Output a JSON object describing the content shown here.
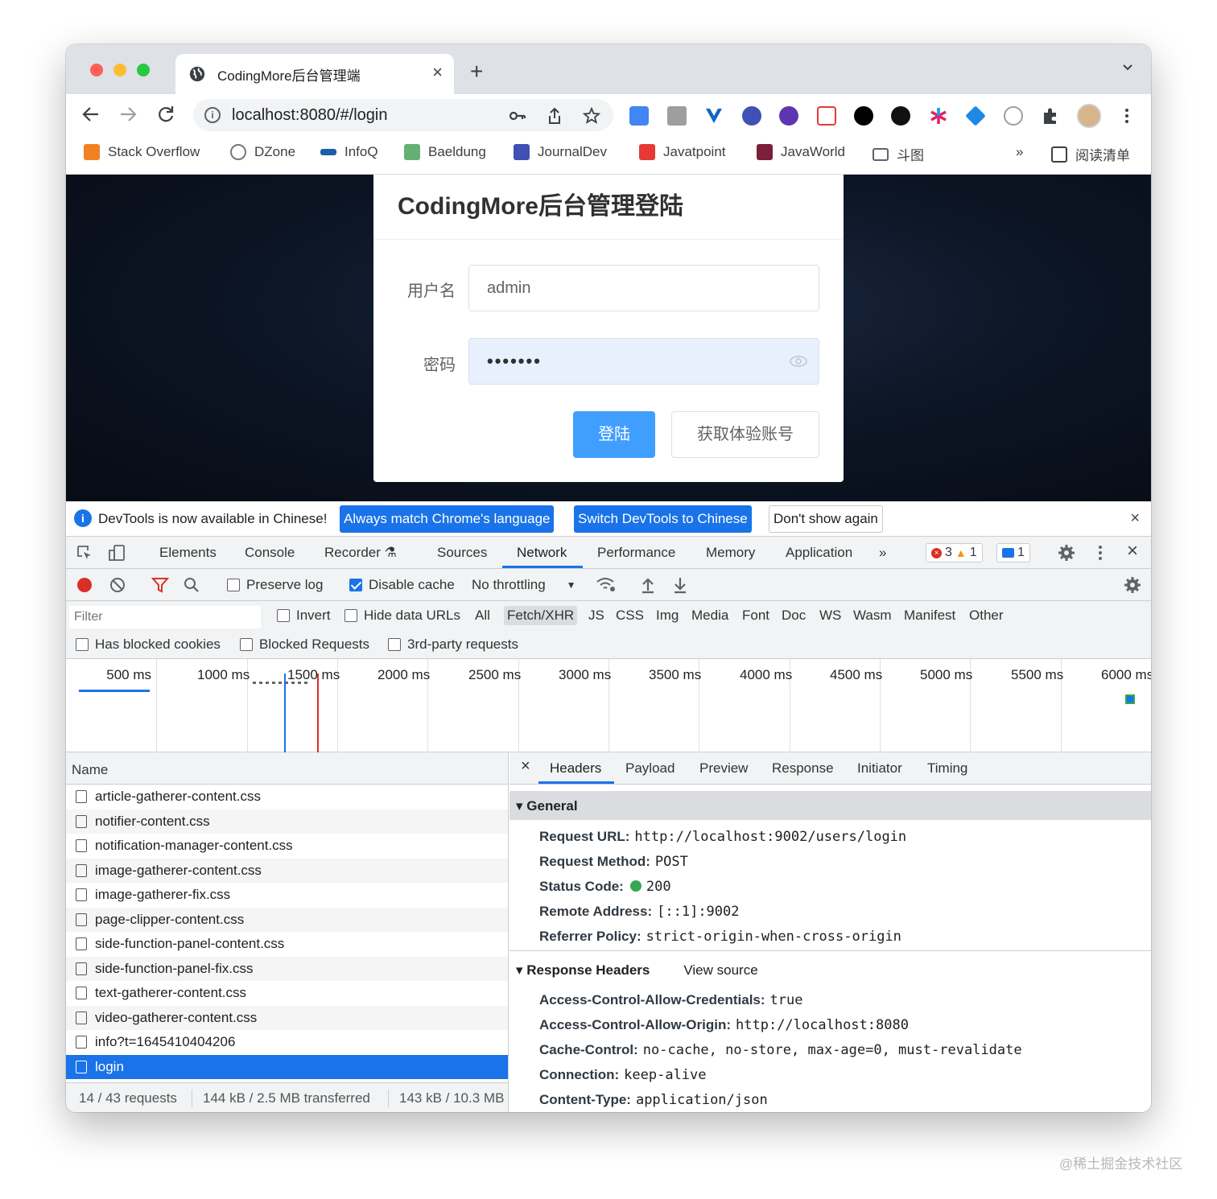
{
  "browser": {
    "tab_title": "CodingMore后台管理端",
    "url": "localhost:8080/#/login",
    "bookmarks": [
      "Stack Overflow",
      "DZone",
      "InfoQ",
      "Baeldung",
      "JournalDev",
      "Javatpoint",
      "JavaWorld",
      "斗图"
    ],
    "overflow": "»",
    "reading_list": "阅读清单"
  },
  "page": {
    "title": "CodingMore后台管理登陆",
    "username_label": "用户名",
    "username_value": "admin",
    "password_label": "密码",
    "password_value": "•••••••",
    "login_button": "登陆",
    "trial_button": "获取体验账号"
  },
  "devtools": {
    "infobar": {
      "message": "DevTools is now available in Chinese!",
      "btn_match": "Always match Chrome's language",
      "btn_switch": "Switch DevTools to Chinese",
      "btn_dismiss": "Don't show again"
    },
    "tabs": [
      "Elements",
      "Console",
      "Recorder",
      "Sources",
      "Network",
      "Performance",
      "Memory",
      "Application"
    ],
    "more_tabs": "»",
    "errors": "3",
    "warnings": "1",
    "messages": "1",
    "network": {
      "preserve_log": "Preserve log",
      "disable_cache": "Disable cache",
      "throttling": "No throttling",
      "filter_placeholder": "Filter",
      "invert": "Invert",
      "hide_data_urls": "Hide data URLs",
      "types": [
        "All",
        "Fetch/XHR",
        "JS",
        "CSS",
        "Img",
        "Media",
        "Font",
        "Doc",
        "WS",
        "Wasm",
        "Manifest",
        "Other"
      ],
      "has_blocked_cookies": "Has blocked cookies",
      "blocked_requests": "Blocked Requests",
      "third_party": "3rd-party requests",
      "timeline_ticks": [
        "500 ms",
        "1000 ms",
        "1500 ms",
        "2000 ms",
        "2500 ms",
        "3000 ms",
        "3500 ms",
        "4000 ms",
        "4500 ms",
        "5000 ms",
        "5500 ms",
        "6000 ms"
      ],
      "name_header": "Name",
      "requests": [
        "article-gatherer-content.css",
        "notifier-content.css",
        "notification-manager-content.css",
        "image-gatherer-content.css",
        "image-gatherer-fix.css",
        "page-clipper-content.css",
        "side-function-panel-content.css",
        "side-function-panel-fix.css",
        "text-gatherer-content.css",
        "video-gatherer-content.css",
        "info?t=1645410404206",
        "login"
      ],
      "status": {
        "requests": "14 / 43 requests",
        "transferred": "144 kB / 2.5 MB transferred",
        "resources": "143 kB / 10.3 MB"
      }
    },
    "detail_tabs": [
      "Headers",
      "Payload",
      "Preview",
      "Response",
      "Initiator",
      "Timing"
    ],
    "general": {
      "title": "General",
      "request_url_k": "Request URL:",
      "request_url_v": "http://localhost:9002/users/login",
      "method_k": "Request Method:",
      "method_v": "POST",
      "status_k": "Status Code:",
      "status_v": "200",
      "remote_k": "Remote Address:",
      "remote_v": "[::1]:9002",
      "referrer_k": "Referrer Policy:",
      "referrer_v": "strict-origin-when-cross-origin"
    },
    "response_headers": {
      "title": "Response Headers",
      "view_source": "View source",
      "acac_k": "Access-Control-Allow-Credentials:",
      "acac_v": "true",
      "acao_k": "Access-Control-Allow-Origin:",
      "acao_v": "http://localhost:8080",
      "cache_k": "Cache-Control:",
      "cache_v": "no-cache, no-store, max-age=0, must-revalidate",
      "conn_k": "Connection:",
      "conn_v": "keep-alive",
      "ctype_k": "Content-Type:",
      "ctype_v": "application/json"
    }
  },
  "watermark": "@稀土掘金技术社区"
}
